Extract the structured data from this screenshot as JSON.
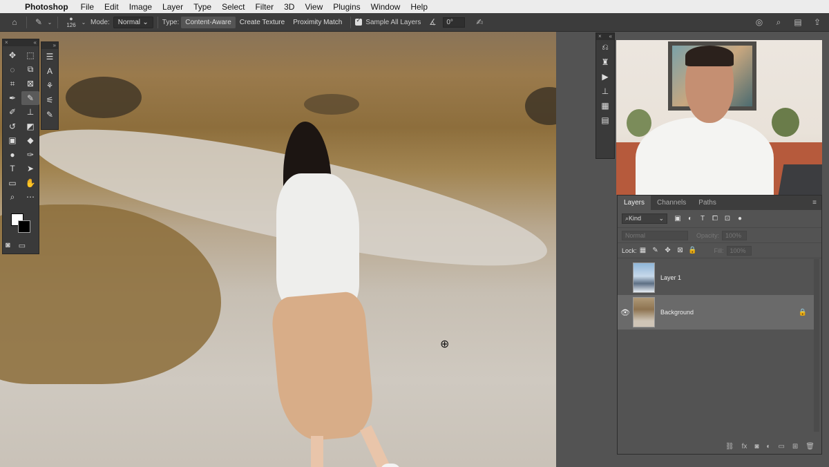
{
  "menubar": {
    "app_name": "Photoshop",
    "items": [
      "File",
      "Edit",
      "Image",
      "Layer",
      "Type",
      "Select",
      "Filter",
      "3D",
      "View",
      "Plugins",
      "Window",
      "Help"
    ]
  },
  "options": {
    "brush_size": "126",
    "mode_label": "Mode:",
    "mode_value": "Normal",
    "type_label": "Type:",
    "type_buttons": [
      "Content-Aware",
      "Create Texture",
      "Proximity Match"
    ],
    "sample_all_layers": "Sample All Layers",
    "angle_value": "0°"
  },
  "layers_panel": {
    "tabs": [
      "Layers",
      "Channels",
      "Paths"
    ],
    "kind_label": "Kind",
    "blend_mode": "Normal",
    "opacity_label": "Opacity:",
    "opacity_value": "100%",
    "lock_label": "Lock:",
    "fill_label": "Fill:",
    "fill_value": "100%",
    "layers": [
      {
        "name": "Layer 1",
        "visible": false
      },
      {
        "name": "Background",
        "visible": true,
        "locked": true
      }
    ]
  }
}
